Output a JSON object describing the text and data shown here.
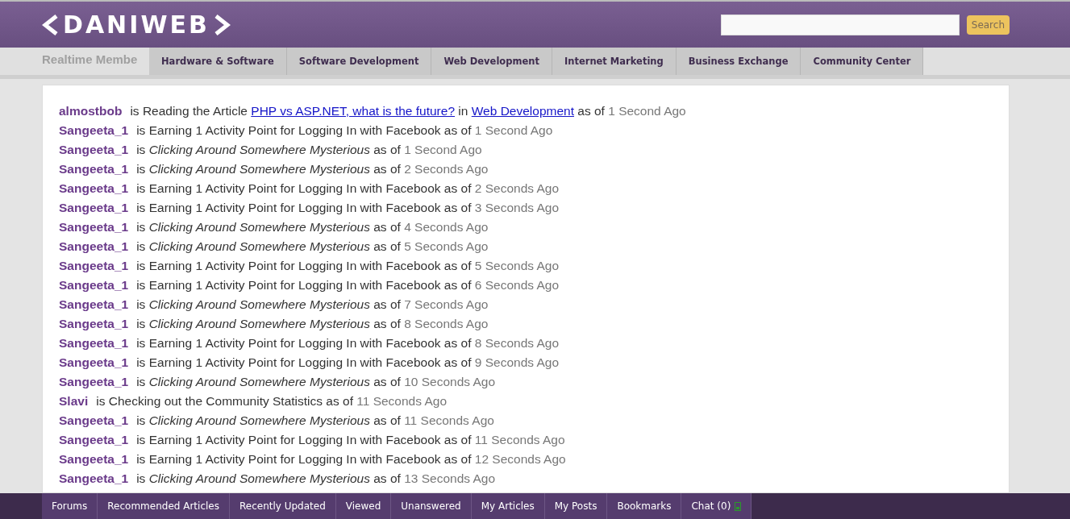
{
  "header": {
    "logo": "DANIWEB",
    "search": {
      "button": "Search"
    }
  },
  "heading": "Realtime Membe",
  "nav": [
    "Hardware & Software",
    "Software Development",
    "Web Development",
    "Internet Marketing",
    "Business Exchange",
    "Community Center"
  ],
  "activity": [
    {
      "user": "almostbob",
      "parts": [
        {
          "kind": "text",
          "text": "is Reading the Article"
        },
        {
          "kind": "link",
          "text": "PHP vs ASP.NET, what is the future?"
        },
        {
          "kind": "text",
          "text": "in"
        },
        {
          "kind": "link",
          "text": "Web Development"
        },
        {
          "kind": "text",
          "text": "as of"
        }
      ],
      "time": "1 Second Ago"
    },
    {
      "user": "Sangeeta_1",
      "parts": [
        {
          "kind": "text",
          "text": "is Earning 1 Activity Point for Logging In with Facebook as of"
        }
      ],
      "time": "1 Second Ago"
    },
    {
      "user": "Sangeeta_1",
      "parts": [
        {
          "kind": "text",
          "text": "is *Clicking Around Somewhere Mysterious* as of"
        }
      ],
      "time": "1 Second Ago"
    },
    {
      "user": "Sangeeta_1",
      "parts": [
        {
          "kind": "text",
          "text": "is *Clicking Around Somewhere Mysterious* as of"
        }
      ],
      "time": "2 Seconds Ago"
    },
    {
      "user": "Sangeeta_1",
      "parts": [
        {
          "kind": "text",
          "text": "is Earning 1 Activity Point for Logging In with Facebook as of"
        }
      ],
      "time": "2 Seconds Ago"
    },
    {
      "user": "Sangeeta_1",
      "parts": [
        {
          "kind": "text",
          "text": "is Earning 1 Activity Point for Logging In with Facebook as of"
        }
      ],
      "time": "3 Seconds Ago"
    },
    {
      "user": "Sangeeta_1",
      "parts": [
        {
          "kind": "text",
          "text": "is *Clicking Around Somewhere Mysterious* as of"
        }
      ],
      "time": "4 Seconds Ago"
    },
    {
      "user": "Sangeeta_1",
      "parts": [
        {
          "kind": "text",
          "text": "is *Clicking Around Somewhere Mysterious* as of"
        }
      ],
      "time": "5 Seconds Ago"
    },
    {
      "user": "Sangeeta_1",
      "parts": [
        {
          "kind": "text",
          "text": "is Earning 1 Activity Point for Logging In with Facebook as of"
        }
      ],
      "time": "5 Seconds Ago"
    },
    {
      "user": "Sangeeta_1",
      "parts": [
        {
          "kind": "text",
          "text": "is Earning 1 Activity Point for Logging In with Facebook as of"
        }
      ],
      "time": "6 Seconds Ago"
    },
    {
      "user": "Sangeeta_1",
      "parts": [
        {
          "kind": "text",
          "text": "is *Clicking Around Somewhere Mysterious* as of"
        }
      ],
      "time": "7 Seconds Ago"
    },
    {
      "user": "Sangeeta_1",
      "parts": [
        {
          "kind": "text",
          "text": "is *Clicking Around Somewhere Mysterious* as of"
        }
      ],
      "time": "8 Seconds Ago"
    },
    {
      "user": "Sangeeta_1",
      "parts": [
        {
          "kind": "text",
          "text": "is Earning 1 Activity Point for Logging In with Facebook as of"
        }
      ],
      "time": "8 Seconds Ago"
    },
    {
      "user": "Sangeeta_1",
      "parts": [
        {
          "kind": "text",
          "text": "is Earning 1 Activity Point for Logging In with Facebook as of"
        }
      ],
      "time": "9 Seconds Ago"
    },
    {
      "user": "Sangeeta_1",
      "parts": [
        {
          "kind": "text",
          "text": "is *Clicking Around Somewhere Mysterious* as of"
        }
      ],
      "time": "10 Seconds Ago"
    },
    {
      "user": "Slavi",
      "parts": [
        {
          "kind": "text",
          "text": "is Checking out the Community Statistics as of"
        }
      ],
      "time": "11 Seconds Ago"
    },
    {
      "user": "Sangeeta_1",
      "parts": [
        {
          "kind": "text",
          "text": "is *Clicking Around Somewhere Mysterious* as of"
        }
      ],
      "time": "11 Seconds Ago"
    },
    {
      "user": "Sangeeta_1",
      "parts": [
        {
          "kind": "text",
          "text": "is Earning 1 Activity Point for Logging In with Facebook as of"
        }
      ],
      "time": "11 Seconds Ago"
    },
    {
      "user": "Sangeeta_1",
      "parts": [
        {
          "kind": "text",
          "text": "is Earning 1 Activity Point for Logging In with Facebook as of"
        }
      ],
      "time": "12 Seconds Ago"
    },
    {
      "user": "Sangeeta_1",
      "parts": [
        {
          "kind": "text",
          "text": "is *Clicking Around Somewhere Mysterious* as of"
        }
      ],
      "time": "13 Seconds Ago"
    }
  ],
  "footer": [
    {
      "label": "Forums"
    },
    {
      "label": "Recommended Articles"
    },
    {
      "label": "Recently Updated"
    },
    {
      "label": "Viewed"
    },
    {
      "label": "Unanswered"
    },
    {
      "label": "My Articles"
    },
    {
      "label": "My Posts"
    },
    {
      "label": "Bookmarks"
    },
    {
      "label": "Chat (0)",
      "icon": true
    }
  ]
}
